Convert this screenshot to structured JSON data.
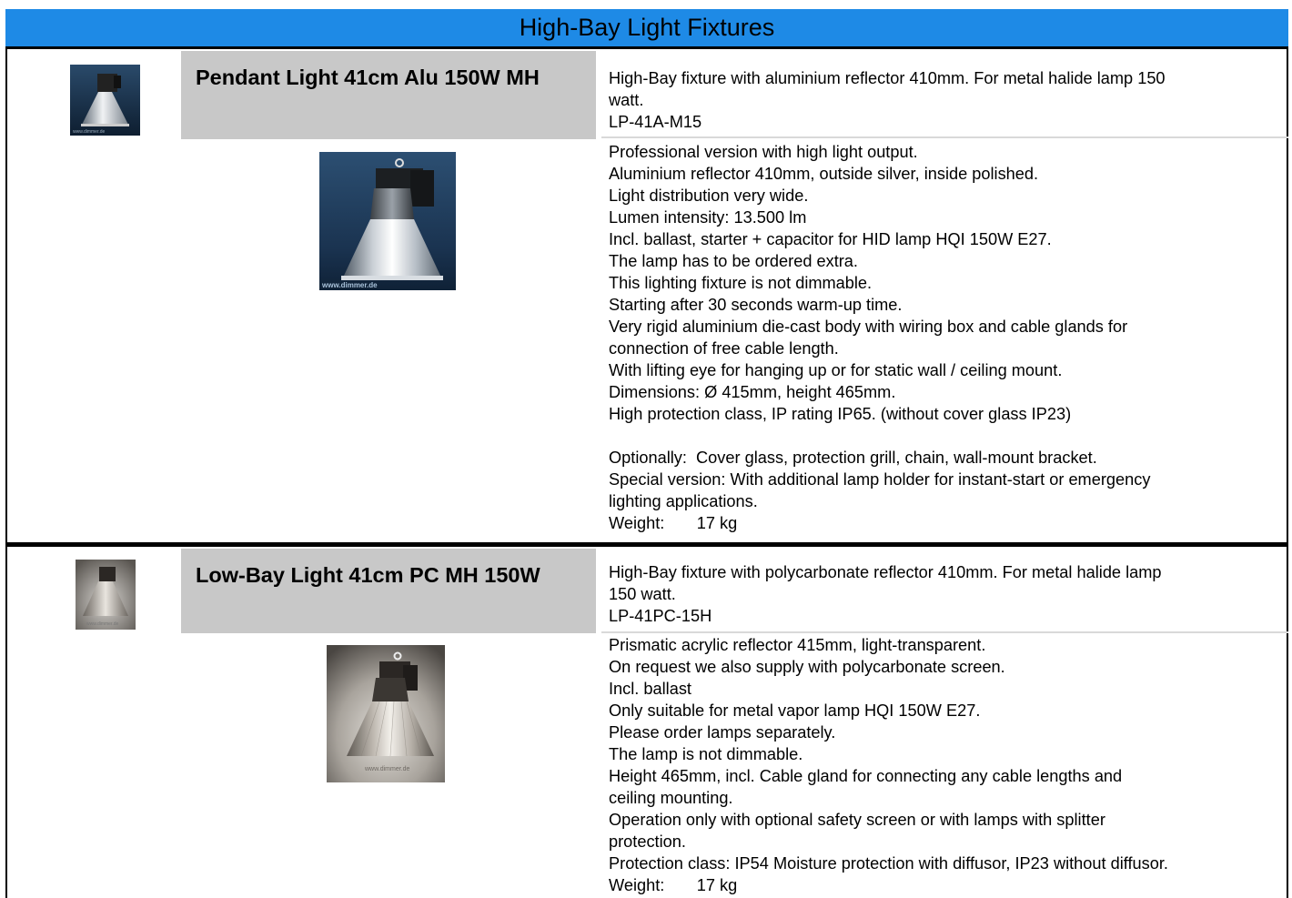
{
  "header": {
    "title": "High-Bay Light Fixtures"
  },
  "products": [
    {
      "title": "Pendant Light 41cm Alu 150W MH",
      "intro": [
        "High-Bay fixture with aluminium reflector 410mm. For metal halide lamp 150",
        "watt.",
        "LP-41A-M15"
      ],
      "details": [
        "Professional version with high light output.",
        "Aluminium reflector 410mm, outside silver, inside polished.",
        "Light distribution very wide.",
        "Lumen intensity: 13.500 lm",
        "Incl. ballast, starter + capacitor for HID lamp HQI 150W E27.",
        "The lamp has to be ordered extra.",
        "This lighting fixture is not dimmable.",
        "Starting after 30 seconds warm-up time.",
        "Very rigid aluminium die-cast body with wiring box and cable glands for",
        "connection of free cable length.",
        "With lifting eye for hanging up or for static wall / ceiling mount.",
        "Dimensions: Ø 415mm, height 465mm.",
        "High protection class, IP rating IP65. (without cover glass IP23)",
        "",
        "Optionally:  Cover glass, protection grill, chain, wall-mount bracket.",
        "Special version: With additional lamp holder for instant-start or emergency",
        "lighting applications.",
        "Weight:       17 kg"
      ],
      "watermark": "www.dimmer.de",
      "thumb_watermark": "www.dimmer.de"
    },
    {
      "title": "Low-Bay Light 41cm PC MH 150W",
      "intro": [
        "High-Bay fixture with polycarbonate reflector 410mm. For metal halide lamp",
        "150 watt.",
        "LP-41PC-15H"
      ],
      "details": [
        "Prismatic acrylic reflector 415mm, light-transparent.",
        "On request we also supply with polycarbonate screen.",
        "Incl. ballast",
        "Only suitable for metal vapor lamp HQI 150W E27.",
        "Please order lamps separately.",
        "The lamp is not dimmable.",
        "Height 465mm, incl. Cable gland for connecting any cable lengths and",
        "ceiling mounting.",
        "Operation only with optional safety screen or with lamps with splitter",
        "protection.",
        "Protection class: IP54 Moisture protection with diffusor, IP23 without diffusor.",
        "Weight:       17 kg"
      ],
      "watermark": "www.dimmer.de",
      "thumb_watermark": "www.dimmer.de"
    }
  ],
  "colors": {
    "header_bg": "#1e8ae6",
    "title_bg": "#c8c8c8"
  }
}
